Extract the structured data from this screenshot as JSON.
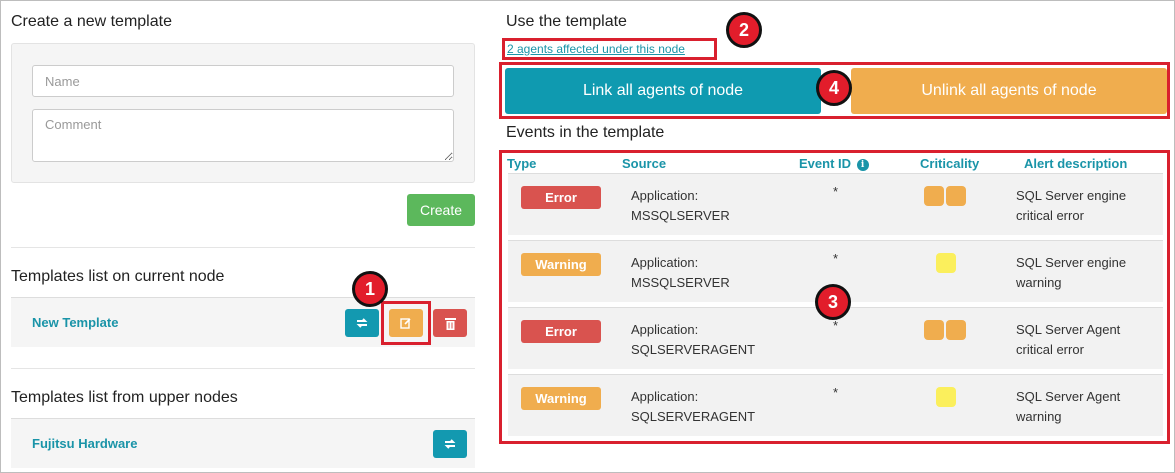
{
  "create": {
    "title": "Create a new template",
    "name_placeholder": "Name",
    "comment_placeholder": "Comment",
    "create_label": "Create"
  },
  "current_node": {
    "title": "Templates list on current node",
    "templates": [
      {
        "name": "New Template"
      }
    ]
  },
  "upper_nodes": {
    "title": "Templates list from upper nodes",
    "templates": [
      {
        "name": "Fujitsu Hardware"
      }
    ]
  },
  "use": {
    "title": "Use the template",
    "affected_link": "2 agents affected under this node",
    "link_all_label": "Link all agents of node",
    "unlink_all_label": "Unlink all agents of node"
  },
  "events": {
    "title": "Events in the template",
    "columns": [
      "Type",
      "Source",
      "Event ID",
      "Criticality",
      "Alert description"
    ],
    "rows": [
      {
        "type": "Error",
        "source": "Application: MSSQLSERVER",
        "event_id": "*",
        "criticality": 2,
        "description": "SQL Server engine critical error"
      },
      {
        "type": "Warning",
        "source": "Application: MSSQLSERVER",
        "event_id": "*",
        "criticality": 1,
        "description": "SQL Server engine warning"
      },
      {
        "type": "Error",
        "source": "Application: SQLSERVERAGENT",
        "event_id": "*",
        "criticality": 2,
        "description": "SQL Server Agent critical error"
      },
      {
        "type": "Warning",
        "source": "Application: SQLSERVERAGENT",
        "event_id": "*",
        "criticality": 1,
        "description": "SQL Server Agent warning"
      }
    ]
  },
  "callouts": [
    "1",
    "2",
    "3",
    "4"
  ],
  "colors": {
    "teal": "#1399b0",
    "orange": "#f0ad4e",
    "red": "#d9534f",
    "green": "#5cb85c",
    "yellow": "#fbef5c",
    "callout_red": "#e21d2b"
  },
  "icons": {
    "sync": "sync-icon",
    "edit": "edit-icon",
    "delete": "trash-icon",
    "info": "info-icon"
  }
}
